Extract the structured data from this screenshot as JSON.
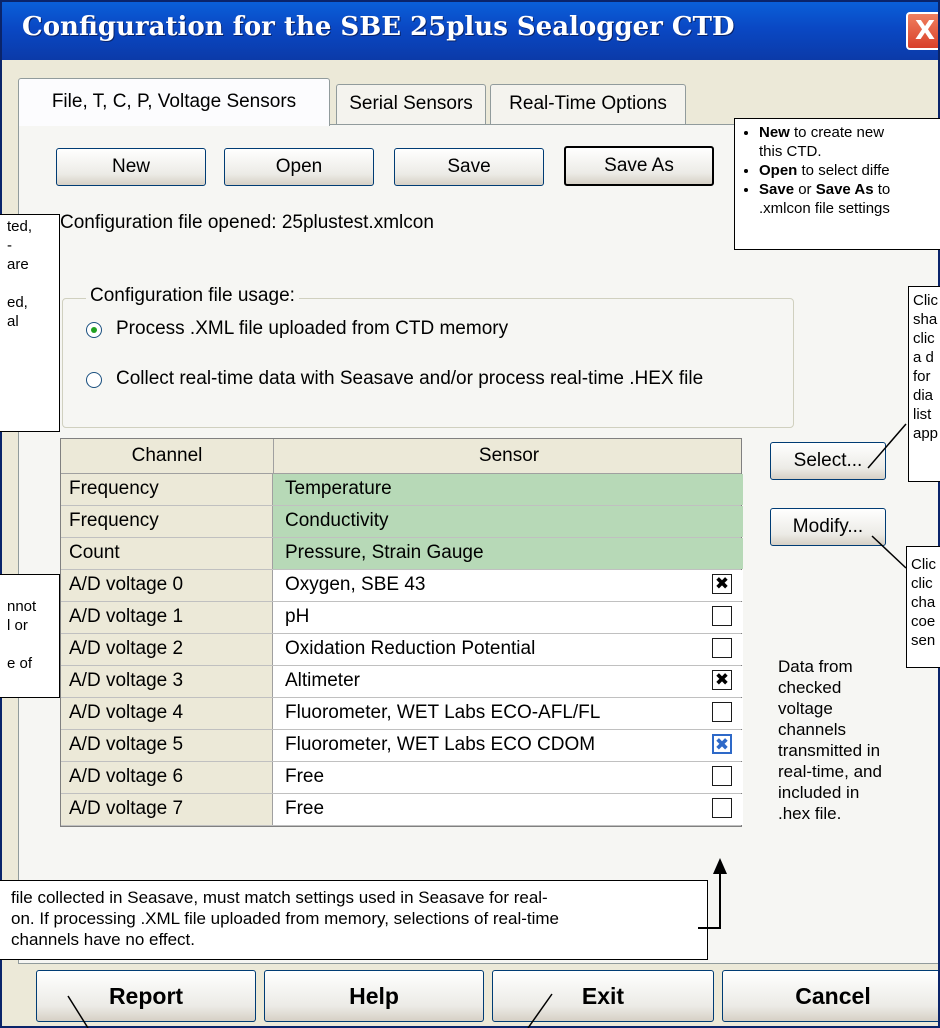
{
  "window": {
    "title": "Configuration for the SBE 25plus Sealogger CTD",
    "close_glyph": "X"
  },
  "tabs": [
    {
      "label": "File, T, C, P, Voltage Sensors",
      "active": true
    },
    {
      "label": "Serial Sensors",
      "active": false
    },
    {
      "label": "Real-Time Options",
      "active": false
    }
  ],
  "toolbar": {
    "new_label": "New",
    "open_label": "Open",
    "save_label": "Save",
    "save_as_label": "Save As"
  },
  "config_file": {
    "opened_text": "Configuration file opened: 25plustest.xmlcon"
  },
  "usage": {
    "legend": "Configuration file usage:",
    "options": [
      {
        "label": "Process .XML file uploaded from CTD memory",
        "selected": true
      },
      {
        "label": "Collect real-time data with Seasave and/or process real-time .HEX file",
        "selected": false
      }
    ]
  },
  "grid": {
    "headers": {
      "channel": "Channel",
      "sensor": "Sensor"
    },
    "rows": [
      {
        "channel": "Frequency",
        "sensor": "Temperature",
        "fixed": true,
        "checkbox": null
      },
      {
        "channel": "Frequency",
        "sensor": "Conductivity",
        "fixed": true,
        "checkbox": null
      },
      {
        "channel": "Count",
        "sensor": "Pressure, Strain Gauge",
        "fixed": true,
        "checkbox": null
      },
      {
        "channel": "A/D voltage 0",
        "sensor": "Oxygen, SBE 43",
        "fixed": false,
        "checkbox": true
      },
      {
        "channel": "A/D voltage 1",
        "sensor": "pH",
        "fixed": false,
        "checkbox": false
      },
      {
        "channel": "A/D voltage 2",
        "sensor": "Oxidation Reduction Potential",
        "fixed": false,
        "checkbox": false
      },
      {
        "channel": "A/D voltage 3",
        "sensor": "Altimeter",
        "fixed": false,
        "checkbox": true
      },
      {
        "channel": "A/D voltage 4",
        "sensor": "Fluorometer, WET Labs ECO-AFL/FL",
        "fixed": false,
        "checkbox": false
      },
      {
        "channel": "A/D voltage 5",
        "sensor": "Fluorometer, WET Labs ECO CDOM",
        "fixed": false,
        "checkbox": true,
        "focused": true
      },
      {
        "channel": "A/D voltage 6",
        "sensor": "Free",
        "fixed": false,
        "checkbox": false
      },
      {
        "channel": "A/D voltage 7",
        "sensor": "Free",
        "fixed": false,
        "checkbox": false
      }
    ]
  },
  "side_buttons": {
    "select_label": "Select...",
    "modify_label": "Modify..."
  },
  "side_note": {
    "lines": [
      "Data from",
      "checked",
      "voltage",
      "channels",
      "transmitted in",
      "real-time, and",
      "included in",
      ".hex file."
    ]
  },
  "bottom_buttons": {
    "report_label": "Report",
    "help_label": "Help",
    "exit_label": "Exit",
    "cancel_label": "Cancel"
  },
  "callouts": {
    "file_ops": {
      "items": [
        {
          "bold": "New",
          "text": " to create new"
        },
        {
          "text": "this CTD."
        },
        {
          "bold": "Open",
          "text": " to select diffe"
        },
        {
          "bold": "Save",
          "mid": " or ",
          "bold2": "Save As",
          "text": " to"
        },
        {
          "text": ".xmlcon file settings"
        }
      ]
    },
    "left_top": {
      "lines": [
        "ted,",
        "-",
        "are",
        "",
        "ed,",
        "al"
      ]
    },
    "left_mid": {
      "lines": [
        "nnot",
        "l or",
        "",
        "e of"
      ]
    },
    "select_tip": {
      "lines": [
        "Clic",
        "sha",
        "clic",
        "a d",
        "for",
        "dia",
        "list",
        "app"
      ]
    },
    "modify_tip": {
      "lines": [
        "Clic",
        "clic",
        "cha",
        "coe",
        "sen"
      ]
    },
    "bottom_note": {
      "lines": [
        "file collected in Seasave, must match settings used in Seasave for real-",
        "on. If processing .XML file uploaded from memory, selections of real-time",
        "channels have no effect."
      ]
    }
  }
}
